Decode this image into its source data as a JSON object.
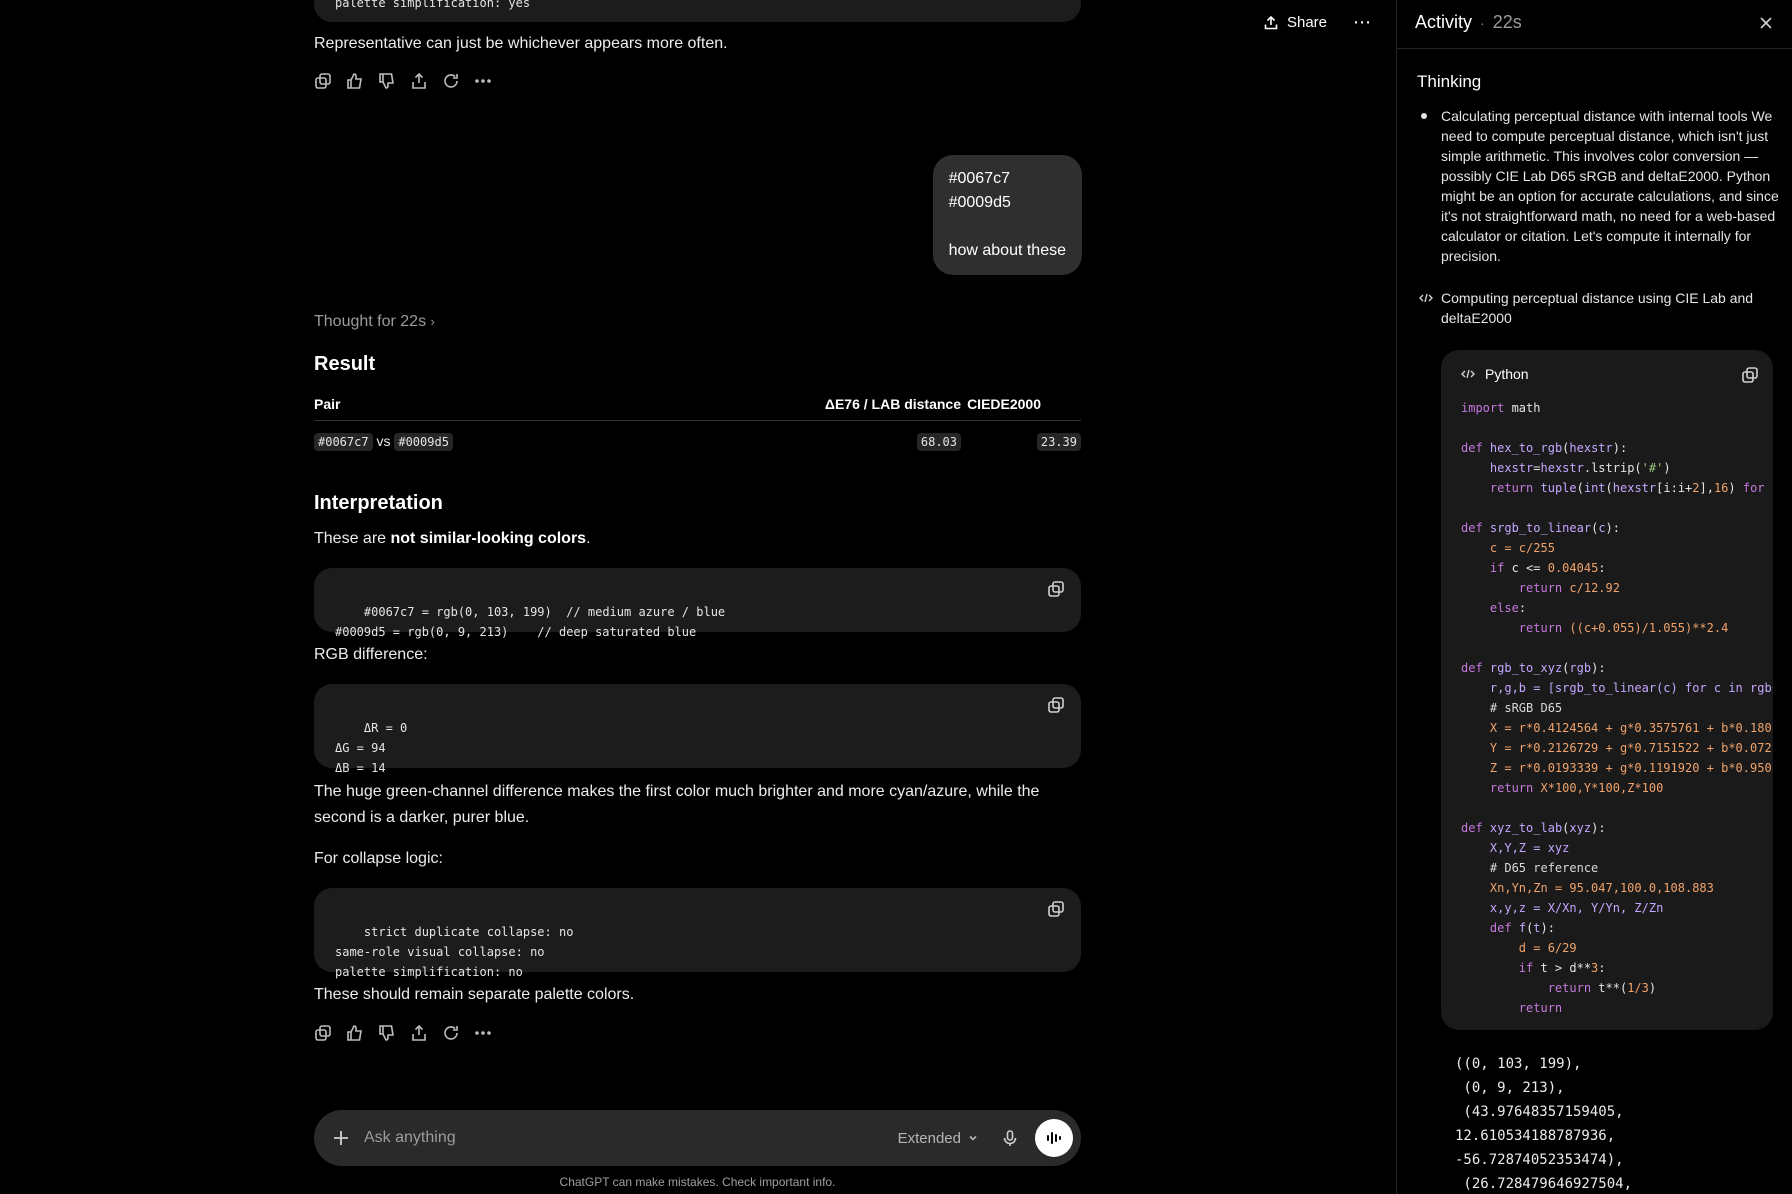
{
  "chat": {
    "top_bar": {
      "share_label": "Share"
    },
    "prev_code_line": "palette simplification: yes",
    "prev_paragraph": "Representative can just be whichever appears more often.",
    "user_message": "#0067c7\n#0009d5\n\nhow about these",
    "thought_label": "Thought for 22s",
    "result_heading": "Result",
    "table": {
      "headers": [
        "Pair",
        "ΔE76 / LAB distance",
        "CIEDE2000"
      ],
      "row": {
        "a": "#0067c7",
        "vs": "vs",
        "b": "#0009d5",
        "de76": "68.03",
        "de2000": "23.39"
      }
    },
    "interp_heading": "Interpretation",
    "interp_pre": "These are ",
    "interp_bold": "not similar-looking colors",
    "interp_post": ".",
    "code1": "#0067c7 = rgb(0, 103, 199)  // medium azure / blue\n#0009d5 = rgb(0, 9, 213)    // deep saturated blue",
    "rgb_diff_label": "RGB difference:",
    "code2": "ΔR = 0\nΔG = 94\nΔB = 14",
    "green_para": "The huge green-channel difference makes the first color much brighter and more cyan/azure, while the second is a darker, purer blue.",
    "collapse_label": "For collapse logic:",
    "code3": "strict duplicate collapse: no\nsame-role visual collapse: no\npalette simplification: no",
    "final_para": "These should remain separate palette colors.",
    "composer": {
      "placeholder": "Ask anything",
      "model_label": "Extended"
    },
    "footnote": "ChatGPT can make mistakes. Check important info."
  },
  "panel": {
    "title": "Activity",
    "duration": "22s",
    "section_title": "Thinking",
    "step1": "Calculating perceptual distance with internal tools We need to compute perceptual distance, which isn't just simple arithmetic. This involves color conversion — possibly CIE Lab D65 sRGB and deltaE2000. Python might be an option for accurate calculations, and since it's not straightforward math, no need for a web-based calculator or citation. Let's compute it internally for precision.",
    "step2": "Computing perceptual distance using CIE Lab and deltaE2000",
    "code_lang": "Python",
    "output": "((0, 103, 199),\n (0, 9, 213),\n (43.97648357159405,\n12.610534188787936,\n-56.72874052353474),\n (26.728479646927504,"
  }
}
